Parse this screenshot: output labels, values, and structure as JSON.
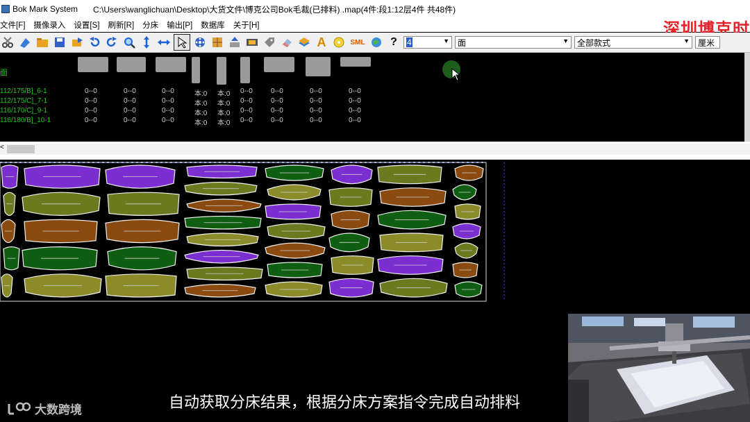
{
  "window": {
    "app_name": "Bok Mark System",
    "file_path": "C:\\Users\\wanglichuan\\Desktop\\大货文件\\博克公司Bok毛裁(已排料)  .map(4件:段1:12层4件 共48件)"
  },
  "menu": {
    "items": [
      "文件[F]",
      "摄像录入",
      "设置[S]",
      "刷新[R]",
      "分床",
      "输出[P]",
      "数据库",
      "关于[H]"
    ]
  },
  "brand": {
    "text": "深圳博克时"
  },
  "toolbar": {
    "icons": [
      "scissor-icon",
      "marker-icon",
      "folder-open-icon",
      "save-icon",
      "export-icon",
      "undo-icon",
      "redo-icon",
      "zoom-icon",
      "vertical-arrows-icon",
      "horizontal-arrows-icon",
      "select-arrow-icon",
      "reel-icon",
      "pattern-icon",
      "upload-icon",
      "film-icon",
      "tag-icon",
      "erase-icon",
      "layers-icon",
      "text-a-icon",
      "cd-icon",
      "sml-icon",
      "globe-icon",
      "help-icon"
    ],
    "text_a": "A",
    "sml_label": "SML",
    "help_label": "?",
    "layer_value": "4",
    "face_value": "面",
    "style_value": "全部款式",
    "unit_value": "厘米",
    "arrow": "▼"
  },
  "panel": {
    "mark": "面",
    "rows": [
      {
        "size": "112/175/B]_6-1",
        "cells": [
          "0--0",
          "0--0",
          "0--0",
          "本:0",
          "本:0",
          "0--0",
          "0--0",
          "0--0",
          "0--0"
        ]
      },
      {
        "size": "112/175/C]_7-1",
        "cells": [
          "0--0",
          "0--0",
          "0--0",
          "本:0",
          "本:0",
          "0--0",
          "0--0",
          "0--0",
          "0--0"
        ]
      },
      {
        "size": "116/170/C]_9-1",
        "cells": [
          "0--0",
          "0--0",
          "0--0",
          "本:0",
          "本:0",
          "0--0",
          "0--0",
          "0--0",
          "0--0"
        ]
      },
      {
        "size": "116/180/B]_10-1",
        "cells": [
          "0--0",
          "0--0",
          "0--0",
          "本:0",
          "本:0",
          "0--0",
          "0--0",
          "0--0",
          "0--0"
        ]
      }
    ]
  },
  "scroll": {
    "left_arrow": "<"
  },
  "layout": {
    "piece_colors": [
      "#7b2fd0",
      "#6b7a1f",
      "#8a4a10",
      "#0f5e12",
      "#8b8b2a"
    ]
  },
  "subtitle": "自动获取分床结果，根据分床方案指令完成自动排料",
  "watermark": "大数跨境"
}
